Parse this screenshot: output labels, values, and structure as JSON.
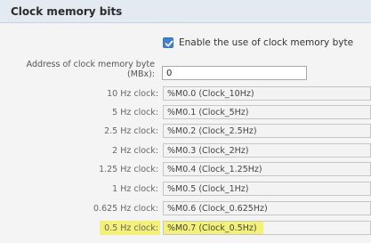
{
  "header": {
    "title": "Clock memory bits"
  },
  "enable_checkbox": {
    "label": "Enable the use of clock memory byte",
    "checked": true
  },
  "address": {
    "label_line1": "Address of clock memory byte",
    "label_line2": "(MBx):",
    "value": "0"
  },
  "highlight_color": "#f2f060",
  "clock_rows": [
    {
      "label": "10 Hz clock:",
      "value": "%M0.0 (Clock_10Hz)"
    },
    {
      "label": "5 Hz clock:",
      "value": "%M0.1 (Clock_5Hz)"
    },
    {
      "label": "2.5 Hz clock:",
      "value": "%M0.2 (Clock_2.5Hz)"
    },
    {
      "label": "2 Hz clock:",
      "value": "%M0.3 (Clock_2Hz)"
    },
    {
      "label": "1.25 Hz clock:",
      "value": "%M0.4 (Clock_1.25Hz)"
    },
    {
      "label": "1 Hz clock:",
      "value": "%M0.5 (Clock_1Hz)"
    },
    {
      "label": "0.625 Hz clock:",
      "value": "%M0.6 (Clock_0.625Hz)"
    },
    {
      "label": "0.5 Hz clock:",
      "value": "%M0.7 (Clock_0.5Hz)"
    }
  ]
}
